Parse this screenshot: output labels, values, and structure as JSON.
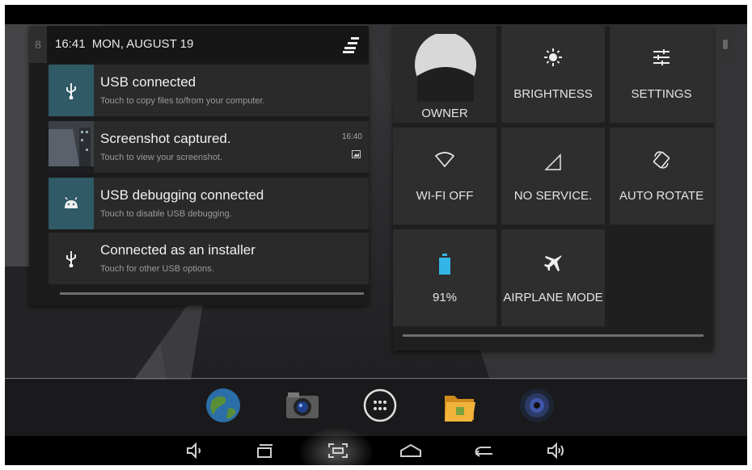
{
  "status": {
    "time": "16:41",
    "date": "MON, AUGUST 19",
    "left_edge_glyph": "8"
  },
  "notifications": [
    {
      "title": "USB connected",
      "subtitle": "Touch to copy files to/from your computer.",
      "icon": "usb-icon",
      "time": ""
    },
    {
      "title": "Screenshot captured.",
      "subtitle": "Touch to view your screenshot.",
      "icon": "screenshot-thumbnail",
      "time": "16:40"
    },
    {
      "title": "USB debugging connected",
      "subtitle": "Touch to disable USB debugging.",
      "icon": "android-icon",
      "time": ""
    },
    {
      "title": "Connected as an installer",
      "subtitle": "Touch for other USB options.",
      "icon": "usb-icon",
      "time": ""
    }
  ],
  "quick_settings": {
    "owner": "OWNER",
    "brightness": "BRIGHTNESS",
    "settings": "SETTINGS",
    "wifi": "WI-FI OFF",
    "signal": "NO SERVICE.",
    "rotate": "AUTO ROTATE",
    "battery": "91%",
    "battery_level": 0.91,
    "airplane": "AIRPLANE MODE"
  },
  "colors": {
    "usb_tile": "#2f5a66",
    "battery": "#33b5e5"
  },
  "dock": [
    "browser-icon",
    "camera-icon",
    "all-apps-icon",
    "file-manager-icon",
    "music-icon"
  ],
  "navbar": [
    "volume-down-icon",
    "recent-apps-icon",
    "screenshot-icon",
    "home-icon",
    "back-icon",
    "volume-up-icon"
  ]
}
